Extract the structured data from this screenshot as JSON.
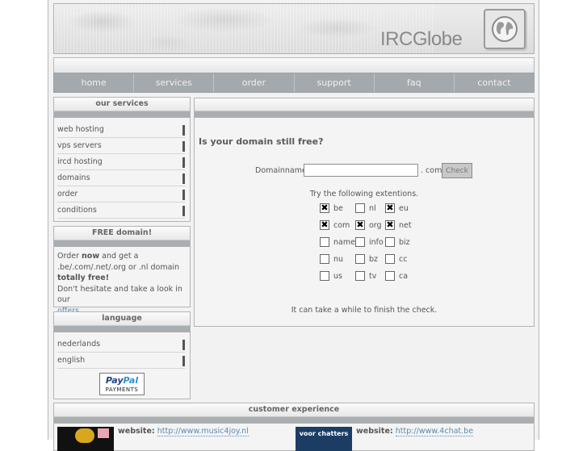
{
  "header": {
    "brand": "IRCGlobe"
  },
  "nav": [
    "home",
    "services",
    "order",
    "support",
    "faq",
    "contact"
  ],
  "services": {
    "title": "our services",
    "items": [
      "web hosting",
      "vps servers",
      "ircd hosting",
      "domains",
      "order",
      "conditions"
    ]
  },
  "free_domain": {
    "title": "FREE domain!",
    "line1_a": "Order ",
    "line1_b": "now",
    "line1_c": " and get a",
    "line2": ".be/.com/.net/.org or .nl domain",
    "line3": "totally free!",
    "line4": "Don't hesitate and take a look in our",
    "link": "offers",
    "period": "."
  },
  "language": {
    "title": "language",
    "items": [
      "nederlands",
      "english"
    ]
  },
  "paypal": {
    "word_a": "Pay",
    "word_b": "Pal",
    "payments": "PAYMENTS"
  },
  "checker": {
    "question": "Is your domain still free?",
    "label": "Domainname:",
    "input_value": "",
    "suffix": ". com",
    "button": "Check",
    "try_text": "Try the following extentions.",
    "note": "It can take a while to finish the check.",
    "extensions": [
      {
        "name": "be",
        "checked": true
      },
      {
        "name": "nl",
        "checked": false
      },
      {
        "name": "eu",
        "checked": true
      },
      {
        "name": "com",
        "checked": true
      },
      {
        "name": "org",
        "checked": true
      },
      {
        "name": "net",
        "checked": true
      },
      {
        "name": "name",
        "checked": false
      },
      {
        "name": "info",
        "checked": false
      },
      {
        "name": "biz",
        "checked": false
      },
      {
        "name": "nu",
        "checked": false
      },
      {
        "name": "bz",
        "checked": false
      },
      {
        "name": "cc",
        "checked": false
      },
      {
        "name": "us",
        "checked": false
      },
      {
        "name": "tv",
        "checked": false
      },
      {
        "name": "ca",
        "checked": false
      }
    ]
  },
  "customers": {
    "title": "customer experience",
    "website_label": "website:",
    "site1": "http://www.music4joy.nl",
    "site2": "http://www.4chat.be",
    "thumb2_text": "voor chatters"
  }
}
